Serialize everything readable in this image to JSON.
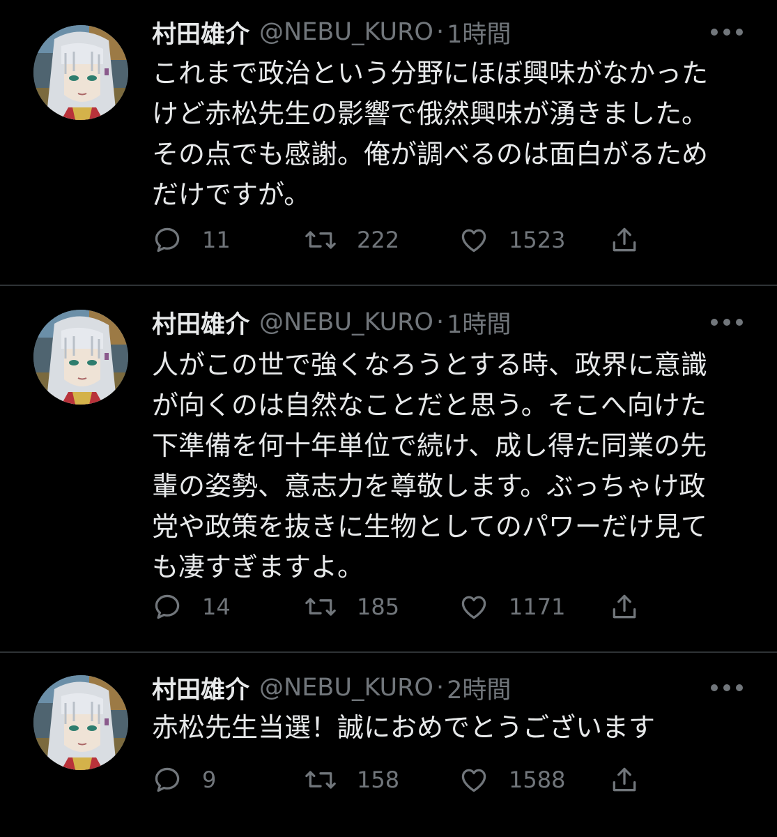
{
  "tweets": [
    {
      "name": "村田雄介",
      "handle": "@NEBU_KURO",
      "dot": "·",
      "time": "1時間",
      "lines": [
        "これまで政治という分野にほぼ興味がなかった",
        "けど赤松先生の影響で俄然興味が湧きました。",
        "その点でも感謝。俺が調べるのは面白がるため",
        "だけですが。"
      ],
      "replies": "11",
      "retweets": "222",
      "likes": "1523"
    },
    {
      "name": "村田雄介",
      "handle": "@NEBU_KURO",
      "dot": "·",
      "time": "1時間",
      "lines": [
        "人がこの世で強くなろうとする時、政界に意識",
        "が向くのは自然なことだと思う。そこへ向けた",
        "下準備を何十年単位で続け、成し得た同業の先",
        "輩の姿勢、意志力を尊敬します。ぶっちゃけ政",
        "党や政策を抜きに生物としてのパワーだけ見て",
        "も凄すぎますよ。"
      ],
      "replies": "14",
      "retweets": "185",
      "likes": "1171"
    },
    {
      "name": "村田雄介",
      "handle": "@NEBU_KURO",
      "dot": "·",
      "time": "2時間",
      "lines": [
        "赤松先生当選！誠におめでとうございます"
      ],
      "replies": "9",
      "retweets": "158",
      "likes": "1588"
    }
  ],
  "icons": {
    "more": "more-dots-icon",
    "reply": "reply-bubble-icon",
    "retweet": "retweet-icon",
    "like": "heart-icon",
    "share": "share-upload-icon"
  },
  "colors": {
    "background": "#000000",
    "text": "#e7e9ea",
    "secondary": "#71767b",
    "divider": "#2f3336"
  }
}
